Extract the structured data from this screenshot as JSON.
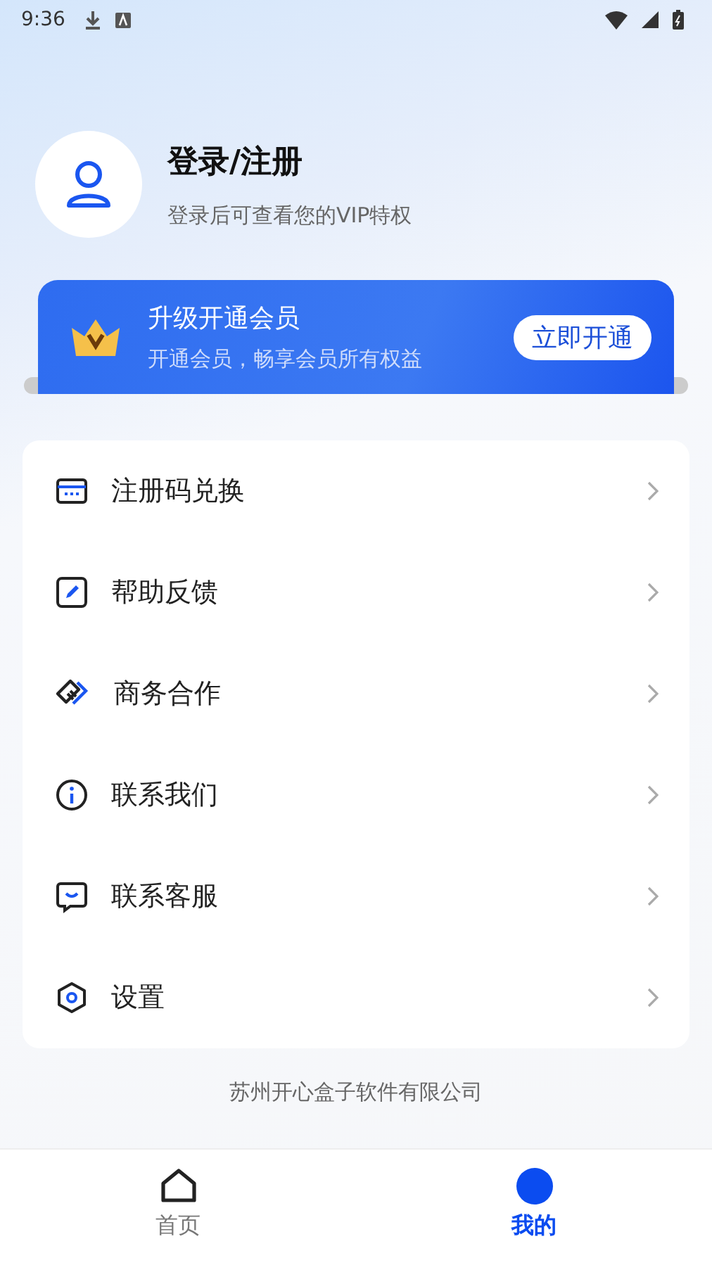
{
  "status_bar": {
    "time": "9:36"
  },
  "profile": {
    "title": "登录/注册",
    "subtitle": "登录后可查看您的VIP特权"
  },
  "vip_banner": {
    "title": "升级开通会员",
    "subtitle": "开通会员，畅享会员所有权益",
    "button": "立即开通"
  },
  "menu": [
    {
      "label": "注册码兑换"
    },
    {
      "label": "帮助反馈"
    },
    {
      "label": "商务合作"
    },
    {
      "label": "联系我们"
    },
    {
      "label": "联系客服"
    },
    {
      "label": "设置"
    }
  ],
  "footer": "苏州开心盒子软件有限公司",
  "tabs": [
    {
      "label": "首页",
      "selected": false
    },
    {
      "label": "我的",
      "selected": true
    }
  ]
}
